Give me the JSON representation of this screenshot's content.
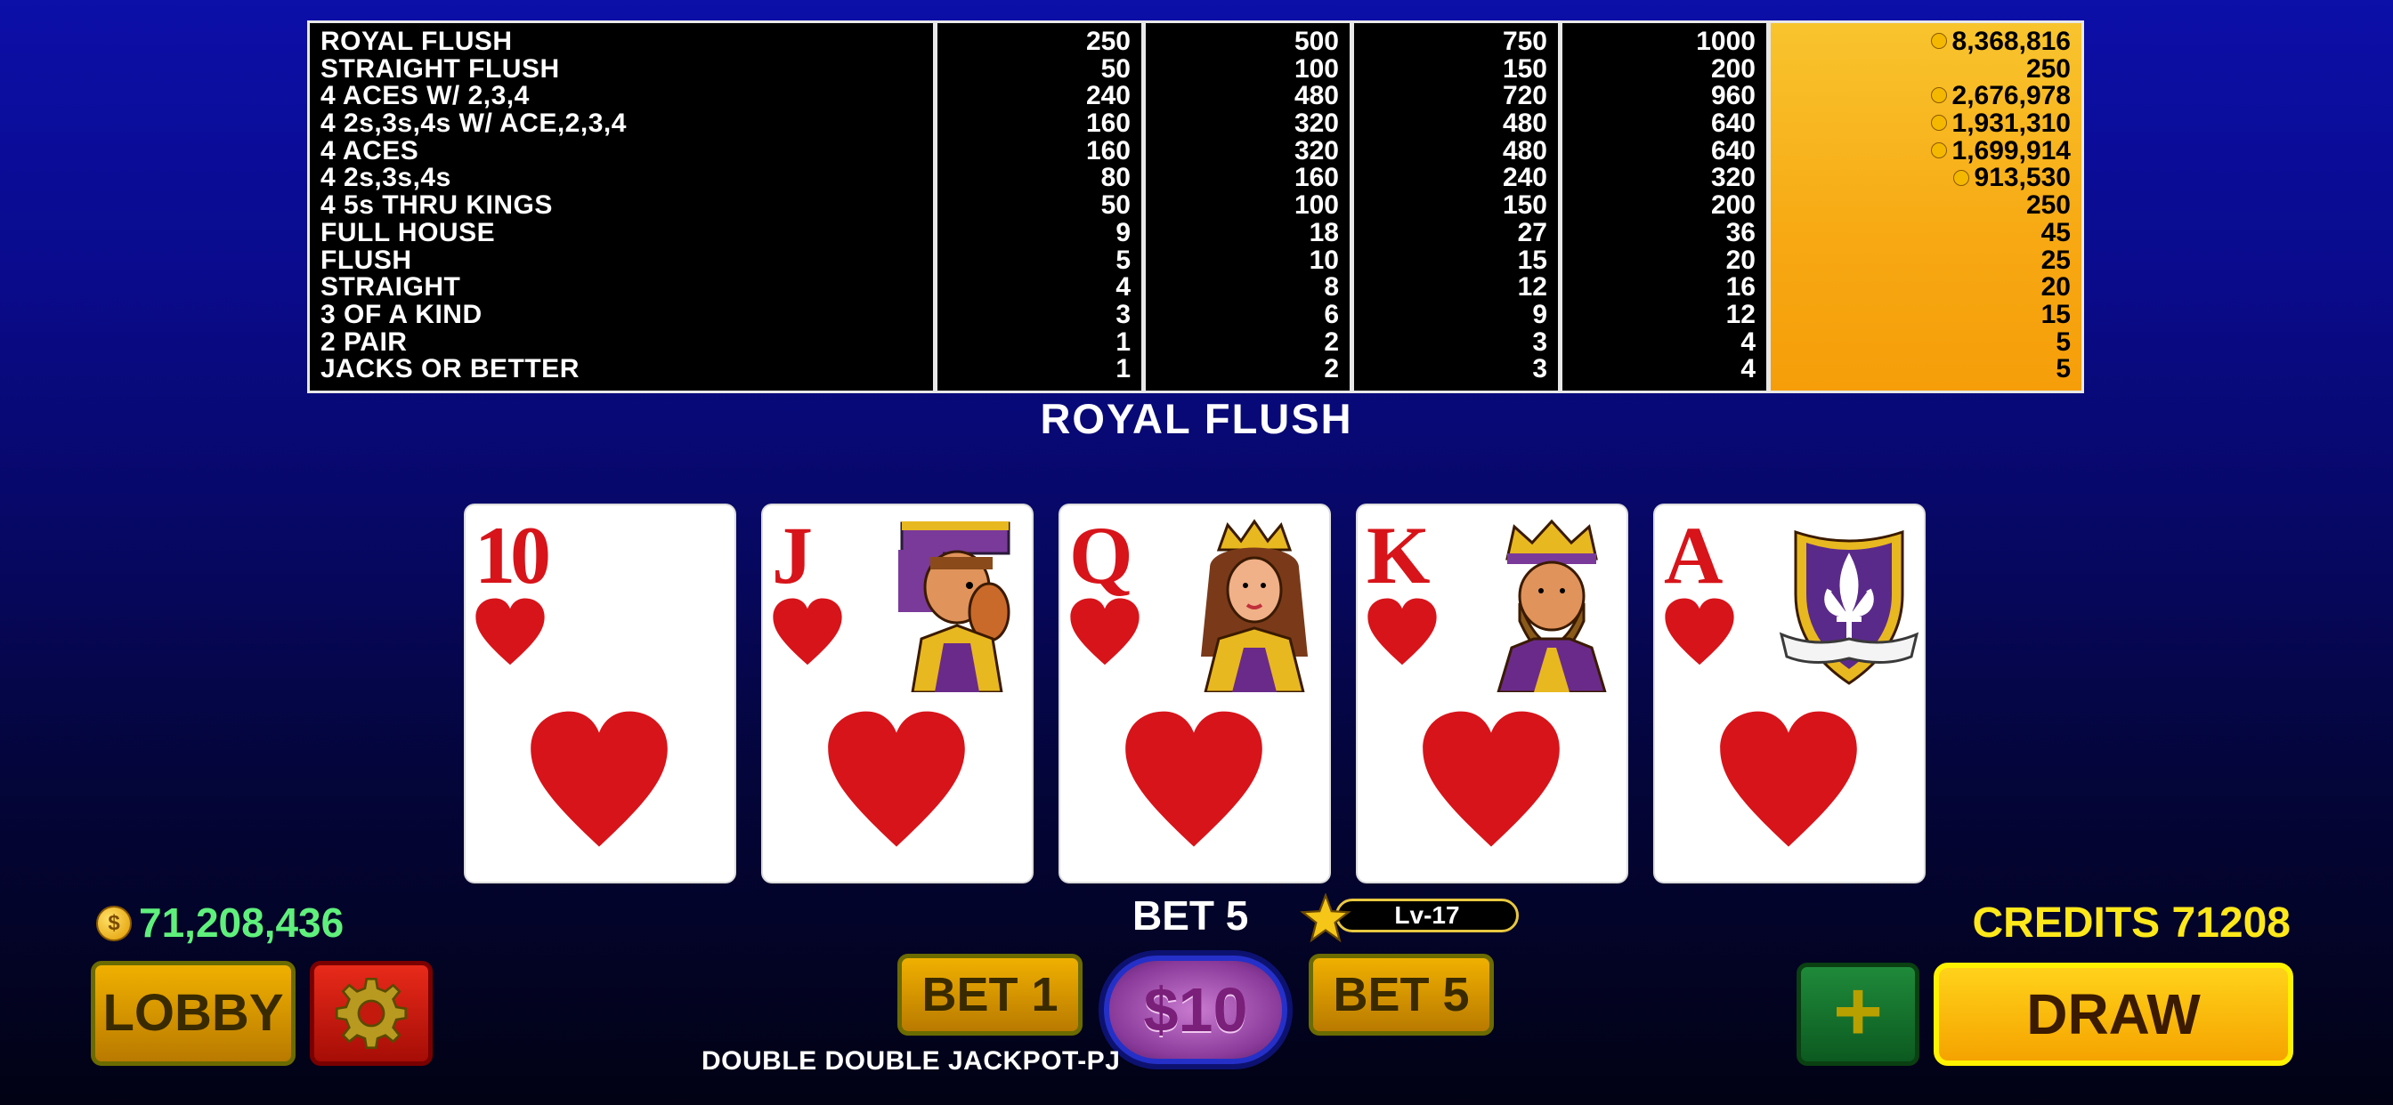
{
  "paytable": {
    "hands": [
      "ROYAL FLUSH",
      "STRAIGHT FLUSH",
      "4 ACES W/ 2,3,4",
      "4 2s,3s,4s W/ ACE,2,3,4",
      "4 ACES",
      "4 2s,3s,4s",
      "4 5s THRU KINGS",
      "FULL HOUSE",
      "FLUSH",
      "STRAIGHT",
      "3 OF A KIND",
      "2 PAIR",
      "JACKS OR BETTER"
    ],
    "col1": [
      "250",
      "50",
      "240",
      "160",
      "160",
      "80",
      "50",
      "9",
      "5",
      "4",
      "3",
      "1",
      "1"
    ],
    "col2": [
      "500",
      "100",
      "480",
      "320",
      "320",
      "160",
      "100",
      "18",
      "10",
      "8",
      "6",
      "2",
      "2"
    ],
    "col3": [
      "750",
      "150",
      "720",
      "480",
      "480",
      "240",
      "150",
      "27",
      "15",
      "12",
      "9",
      "3",
      "3"
    ],
    "col4": [
      "1000",
      "200",
      "960",
      "640",
      "640",
      "320",
      "200",
      "36",
      "20",
      "16",
      "12",
      "4",
      "4"
    ],
    "col5": [
      {
        "coin": true,
        "value": "8,368,816"
      },
      {
        "coin": false,
        "value": "250"
      },
      {
        "coin": true,
        "value": "2,676,978"
      },
      {
        "coin": true,
        "value": "1,931,310"
      },
      {
        "coin": true,
        "value": "1,699,914"
      },
      {
        "coin": true,
        "value": "913,530"
      },
      {
        "coin": false,
        "value": "250"
      },
      {
        "coin": false,
        "value": "45"
      },
      {
        "coin": false,
        "value": "25"
      },
      {
        "coin": false,
        "value": "20"
      },
      {
        "coin": false,
        "value": "15"
      },
      {
        "coin": false,
        "value": "5"
      },
      {
        "coin": false,
        "value": "5"
      }
    ],
    "highlight_color": "#f7a812"
  },
  "hand_result": "ROYAL FLUSH",
  "cards": [
    {
      "rank": "10",
      "suit": "hearts",
      "face": "none"
    },
    {
      "rank": "J",
      "suit": "hearts",
      "face": "jack"
    },
    {
      "rank": "Q",
      "suit": "hearts",
      "face": "queen"
    },
    {
      "rank": "K",
      "suit": "hearts",
      "face": "king"
    },
    {
      "rank": "A",
      "suit": "hearts",
      "face": "shield-fleur-de-lis"
    }
  ],
  "footer": {
    "balance": "71,208,436",
    "coin_symbol": "$",
    "bet_text": "BET 5",
    "level": "Lv-17",
    "credits": "CREDITS 71208",
    "lobby_label": "LOBBY",
    "bet1_label": "BET 1",
    "denom_label": "$10",
    "bet5_label": "BET 5",
    "plus_label": "+",
    "draw_label": "DRAW",
    "game_name": "DOUBLE DOUBLE JACKPOT-PJ"
  },
  "colors": {
    "suit_red": "#d7141a",
    "balance_green": "#5ff07c",
    "credits_yellow": "#ffe81a"
  }
}
